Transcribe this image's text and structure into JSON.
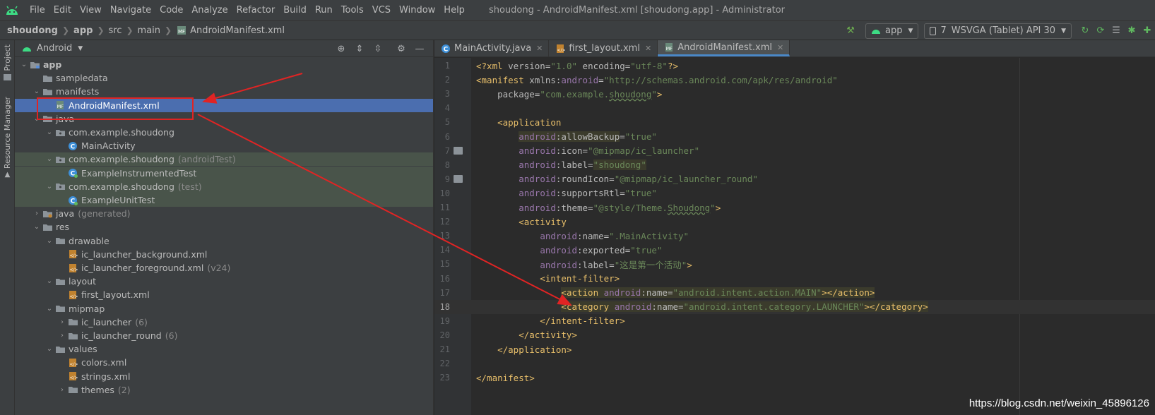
{
  "menu": {
    "items": [
      "File",
      "Edit",
      "View",
      "Navigate",
      "Code",
      "Analyze",
      "Refactor",
      "Build",
      "Run",
      "Tools",
      "VCS",
      "Window",
      "Help"
    ],
    "window_title": "shoudong - AndroidManifest.xml [shoudong.app] - Administrator"
  },
  "breadcrumb": [
    "shoudong",
    "app",
    "src",
    "main",
    "AndroidManifest.xml"
  ],
  "toolbar": {
    "run_config": "app",
    "device_number": "7",
    "device": "WSVGA (Tablet) API 30"
  },
  "side_tabs": {
    "project": "Project",
    "resource_manager": "Resource Manager"
  },
  "project_panel": {
    "view_selector": "Android",
    "tree": [
      {
        "label": "app",
        "hint": "",
        "level": 0,
        "expanded": true,
        "icon": "module-folder-icon",
        "bold": true
      },
      {
        "label": "sampledata",
        "hint": "",
        "level": 1,
        "expanded": null,
        "icon": "folder-icon"
      },
      {
        "label": "manifests",
        "hint": "",
        "level": 1,
        "expanded": true,
        "icon": "folder-icon"
      },
      {
        "label": "AndroidManifest.xml",
        "hint": "",
        "level": 2,
        "expanded": null,
        "icon": "manifest-file-icon",
        "selected": true
      },
      {
        "label": "java",
        "hint": "",
        "level": 1,
        "expanded": true,
        "icon": "folder-icon"
      },
      {
        "label": "com.example.shoudong",
        "hint": "",
        "level": 2,
        "expanded": true,
        "icon": "package-icon"
      },
      {
        "label": "MainActivity",
        "hint": "",
        "level": 3,
        "expanded": null,
        "icon": "class-icon"
      },
      {
        "label": "com.example.shoudong",
        "hint": "(androidTest)",
        "level": 2,
        "expanded": true,
        "icon": "package-icon",
        "test": true
      },
      {
        "label": "ExampleInstrumentedTest",
        "hint": "",
        "level": 3,
        "expanded": null,
        "icon": "test-class-icon",
        "test": true
      },
      {
        "label": "com.example.shoudong",
        "hint": "(test)",
        "level": 2,
        "expanded": true,
        "icon": "package-icon",
        "test": true
      },
      {
        "label": "ExampleUnitTest",
        "hint": "",
        "level": 3,
        "expanded": null,
        "icon": "test-class-icon",
        "test": true
      },
      {
        "label": "java",
        "hint": "(generated)",
        "level": 1,
        "expanded": false,
        "icon": "generated-folder-icon"
      },
      {
        "label": "res",
        "hint": "",
        "level": 1,
        "expanded": true,
        "icon": "folder-icon"
      },
      {
        "label": "drawable",
        "hint": "",
        "level": 2,
        "expanded": true,
        "icon": "folder-icon"
      },
      {
        "label": "ic_launcher_background.xml",
        "hint": "",
        "level": 3,
        "expanded": null,
        "icon": "xml-file-icon"
      },
      {
        "label": "ic_launcher_foreground.xml",
        "hint": "(v24)",
        "level": 3,
        "expanded": null,
        "icon": "xml-file-icon"
      },
      {
        "label": "layout",
        "hint": "",
        "level": 2,
        "expanded": true,
        "icon": "folder-icon"
      },
      {
        "label": "first_layout.xml",
        "hint": "",
        "level": 3,
        "expanded": null,
        "icon": "xml-file-icon"
      },
      {
        "label": "mipmap",
        "hint": "",
        "level": 2,
        "expanded": true,
        "icon": "folder-icon"
      },
      {
        "label": "ic_launcher",
        "hint": "(6)",
        "level": 3,
        "expanded": false,
        "icon": "folder-icon"
      },
      {
        "label": "ic_launcher_round",
        "hint": "(6)",
        "level": 3,
        "expanded": false,
        "icon": "folder-icon"
      },
      {
        "label": "values",
        "hint": "",
        "level": 2,
        "expanded": true,
        "icon": "folder-icon"
      },
      {
        "label": "colors.xml",
        "hint": "",
        "level": 3,
        "expanded": null,
        "icon": "xml-file-icon"
      },
      {
        "label": "strings.xml",
        "hint": "",
        "level": 3,
        "expanded": null,
        "icon": "xml-file-icon"
      },
      {
        "label": "themes",
        "hint": "(2)",
        "level": 3,
        "expanded": false,
        "icon": "folder-icon"
      }
    ]
  },
  "editor": {
    "tabs": [
      {
        "label": "MainActivity.java",
        "icon": "class-icon",
        "active": false
      },
      {
        "label": "first_layout.xml",
        "icon": "xml-file-icon",
        "active": false
      },
      {
        "label": "AndroidManifest.xml",
        "icon": "manifest-file-icon",
        "active": true
      }
    ],
    "current_line": 18,
    "lines": [
      [
        [
          "k",
          "<?xml "
        ],
        [
          "a",
          "version="
        ],
        [
          "s",
          "\"1.0\""
        ],
        [
          "a",
          " encoding="
        ],
        [
          "s",
          "\"utf-8\""
        ],
        [
          "k",
          "?>"
        ]
      ],
      [
        [
          "k",
          "<manifest "
        ],
        [
          "a",
          "xmlns:"
        ],
        [
          "ns",
          "android"
        ],
        [
          "a",
          "="
        ],
        [
          "s",
          "\"http://schemas.android.com/apk/res/android\""
        ]
      ],
      [
        [
          "a",
          "    package="
        ],
        [
          "s",
          "\"com.example."
        ],
        [
          "s u",
          "shoudong"
        ],
        [
          "s",
          "\""
        ],
        [
          "k",
          ">"
        ]
      ],
      [],
      [
        [
          "k",
          "    <application"
        ]
      ],
      [
        [
          "t",
          "        "
        ],
        [
          "ns hl2",
          "android"
        ],
        [
          "a hl2",
          ":allowBackup"
        ],
        [
          "a",
          "="
        ],
        [
          "s",
          "\"true\""
        ]
      ],
      [
        [
          "t",
          "        "
        ],
        [
          "ns",
          "android"
        ],
        [
          "a",
          ":icon="
        ],
        [
          "s",
          "\"@mipmap/ic_launcher\""
        ]
      ],
      [
        [
          "t",
          "        "
        ],
        [
          "ns",
          "android"
        ],
        [
          "a",
          ":label="
        ],
        [
          "s hl2",
          "\"shoudong\""
        ]
      ],
      [
        [
          "t",
          "        "
        ],
        [
          "ns",
          "android"
        ],
        [
          "a",
          ":roundIcon="
        ],
        [
          "s",
          "\"@mipmap/ic_launcher_round\""
        ]
      ],
      [
        [
          "t",
          "        "
        ],
        [
          "ns",
          "android"
        ],
        [
          "a",
          ":supportsRtl="
        ],
        [
          "s",
          "\"true\""
        ]
      ],
      [
        [
          "t",
          "        "
        ],
        [
          "ns",
          "android"
        ],
        [
          "a",
          ":theme="
        ],
        [
          "s",
          "\"@style/Theme."
        ],
        [
          "s u",
          "Shoudong"
        ],
        [
          "s",
          "\""
        ],
        [
          "k",
          ">"
        ]
      ],
      [
        [
          "k",
          "        <activity"
        ]
      ],
      [
        [
          "t",
          "            "
        ],
        [
          "ns",
          "android"
        ],
        [
          "a",
          ":name="
        ],
        [
          "s",
          "\".MainActivity\""
        ]
      ],
      [
        [
          "t",
          "            "
        ],
        [
          "ns",
          "android"
        ],
        [
          "a",
          ":exported="
        ],
        [
          "s",
          "\"true\""
        ]
      ],
      [
        [
          "t",
          "            "
        ],
        [
          "ns",
          "android"
        ],
        [
          "a",
          ":label="
        ],
        [
          "s",
          "\"这是第一个活动\""
        ],
        [
          "k",
          ">"
        ]
      ],
      [
        [
          "k",
          "            <intent-filter>"
        ]
      ],
      [
        [
          "t",
          "                "
        ],
        [
          "k hl2",
          "<action "
        ],
        [
          "ns hl2",
          "android"
        ],
        [
          "a hl2",
          ":name="
        ],
        [
          "s hl2",
          "\"android.intent.action.MAIN\""
        ],
        [
          "k hl2",
          "></action>"
        ]
      ],
      [
        [
          "t",
          "                "
        ],
        [
          "k hl2",
          "<category "
        ],
        [
          "ns hl2",
          "android"
        ],
        [
          "a hl2",
          ":name="
        ],
        [
          "s hl2",
          "\"android.intent.category.LAUNCHER\""
        ],
        [
          "k hl2",
          "></category>"
        ]
      ],
      [
        [
          "k",
          "            </intent-filter>"
        ]
      ],
      [
        [
          "k",
          "        </activity>"
        ]
      ],
      [
        [
          "k",
          "    </application>"
        ]
      ],
      [],
      [
        [
          "k",
          "</manifest>"
        ]
      ]
    ],
    "gutter_image_lines": [
      7,
      9
    ]
  },
  "watermark": "https://blog.csdn.net/weixin_45896126",
  "colors": {
    "background": "#2b2b2b",
    "panel": "#3c3f41",
    "selection": "#4b6eaf",
    "tag": "#e8bf6a",
    "attribute": "#bababa",
    "namespace": "#9876aa",
    "string": "#6a8759",
    "annotation_red": "#e02424"
  }
}
